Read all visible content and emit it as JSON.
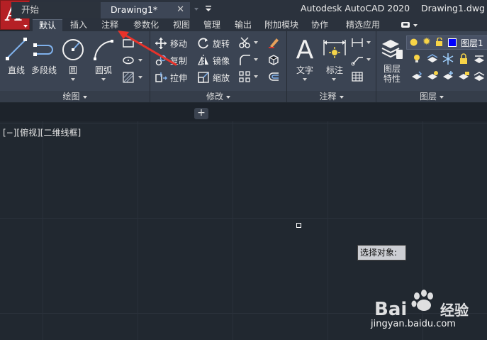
{
  "app": {
    "title": "Autodesk AutoCAD 2020",
    "document": "Drawing1.dwg",
    "logo_letter": "A",
    "accent_color": "#b52025"
  },
  "quick_access": [
    {
      "icon": "new-icon"
    },
    {
      "icon": "open-icon"
    },
    {
      "icon": "save-icon"
    },
    {
      "icon": "save-as-icon"
    },
    {
      "icon": "web-mobile-open-icon"
    },
    {
      "icon": "web-mobile-save-icon"
    },
    {
      "icon": "plot-icon"
    },
    {
      "icon": "undo-icon"
    },
    {
      "icon": "redo-icon"
    },
    {
      "icon": "customize-qa-icon"
    }
  ],
  "ribbon_tabs": [
    {
      "label": "默认",
      "active": true
    },
    {
      "label": "插入"
    },
    {
      "label": "注释"
    },
    {
      "label": "参数化"
    },
    {
      "label": "视图"
    },
    {
      "label": "管理"
    },
    {
      "label": "输出"
    },
    {
      "label": "附加模块"
    },
    {
      "label": "协作"
    },
    {
      "label": "精选应用"
    }
  ],
  "panels": {
    "draw": {
      "title": "绘图",
      "tools": [
        {
          "label": "直线",
          "icon": "line-icon"
        },
        {
          "label": "多段线",
          "icon": "polyline-icon"
        },
        {
          "label": "圆",
          "icon": "circle-icon"
        },
        {
          "label": "圆弧",
          "icon": "arc-icon"
        }
      ]
    },
    "modify": {
      "title": "修改",
      "tools": [
        {
          "label": "移动",
          "icon": "move-icon"
        },
        {
          "label": "旋转",
          "icon": "rotate-icon"
        },
        {
          "label": "复制",
          "icon": "copy-icon"
        },
        {
          "label": "镜像",
          "icon": "mirror-icon"
        },
        {
          "label": "拉伸",
          "icon": "stretch-icon"
        },
        {
          "label": "缩放",
          "icon": "scale-icon"
        }
      ]
    },
    "annotation": {
      "title": "注释",
      "tools": [
        {
          "label": "文字",
          "icon": "text-icon"
        },
        {
          "label": "标注",
          "icon": "dimension-icon"
        }
      ]
    },
    "layers": {
      "title": "图层",
      "tools": [
        {
          "label": "图层\n特性",
          "label_line1": "图层",
          "label_line2": "特性",
          "icon": "layer-properties-icon"
        }
      ],
      "current_layer": "图层1",
      "layer_color": "#0000ff"
    }
  },
  "file_tabs": [
    {
      "label": "开始"
    },
    {
      "label": "Drawing1*",
      "active": true
    }
  ],
  "viewport": {
    "label": "[−][俯视][二维线框]"
  },
  "command_prompt": "选择对象:",
  "watermark": {
    "brand": "Bai 经验",
    "url": "jingyan.baidu.com"
  }
}
